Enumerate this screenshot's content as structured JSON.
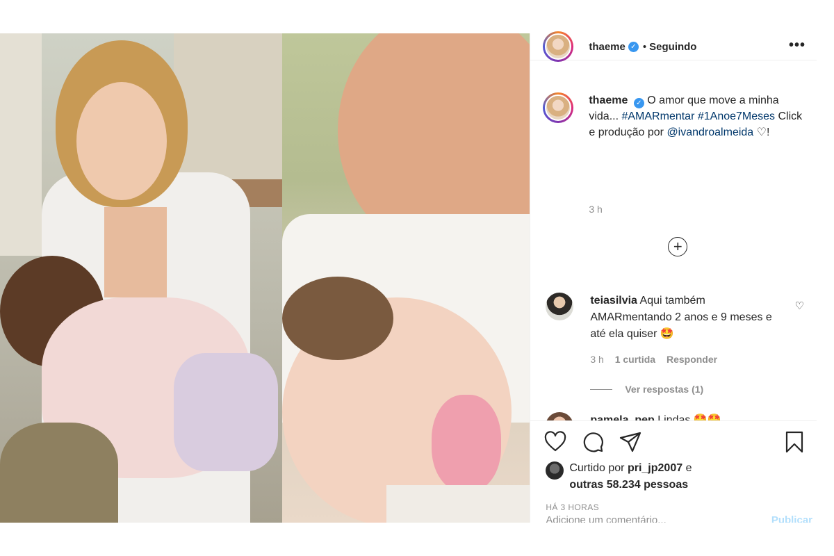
{
  "post": {
    "username": "thaeme",
    "follow_status": "Seguindo",
    "separator": "•",
    "more_label": "•••",
    "caption": {
      "username": "thaeme",
      "text_start": "O amor que move a minha vida...",
      "hashtag1": "#AMARmentar",
      "hashtag2": "#1Anoe7Meses",
      "text_mid": "Click e produção por",
      "mention": "@ivandroalmeida",
      "heart": "♡",
      "text_end": "!",
      "time": "3 h"
    },
    "load_more_label": "+",
    "comments": [
      {
        "username": "teiasilvia",
        "text": "Aqui também AMARmentando 2 anos e 9 meses e até ela quiser 🤩",
        "time": "3 h",
        "likes": "1 curtida",
        "reply": "Responder",
        "view_replies": "Ver respostas (1)"
      },
      {
        "username": "pamela_pep",
        "text": "Lindas 🤩🤩"
      }
    ],
    "liked_by_prefix": "Curtido por",
    "liked_by_user": "pri_jp2007",
    "liked_by_conj": "e",
    "liked_by_others": "outras 58.234 pessoas",
    "timestamp": "HÁ 3 HORAS",
    "add_comment_placeholder": "Adicione um comentário...",
    "publish_label": "Publicar"
  },
  "colors": {
    "link": "#00376b",
    "verified": "#3897f0",
    "muted": "#8e8e8e"
  },
  "icons": [
    "more-icon",
    "verified-icon",
    "heart-icon",
    "comment-icon",
    "share-icon",
    "save-icon",
    "plus-circle-icon"
  ]
}
